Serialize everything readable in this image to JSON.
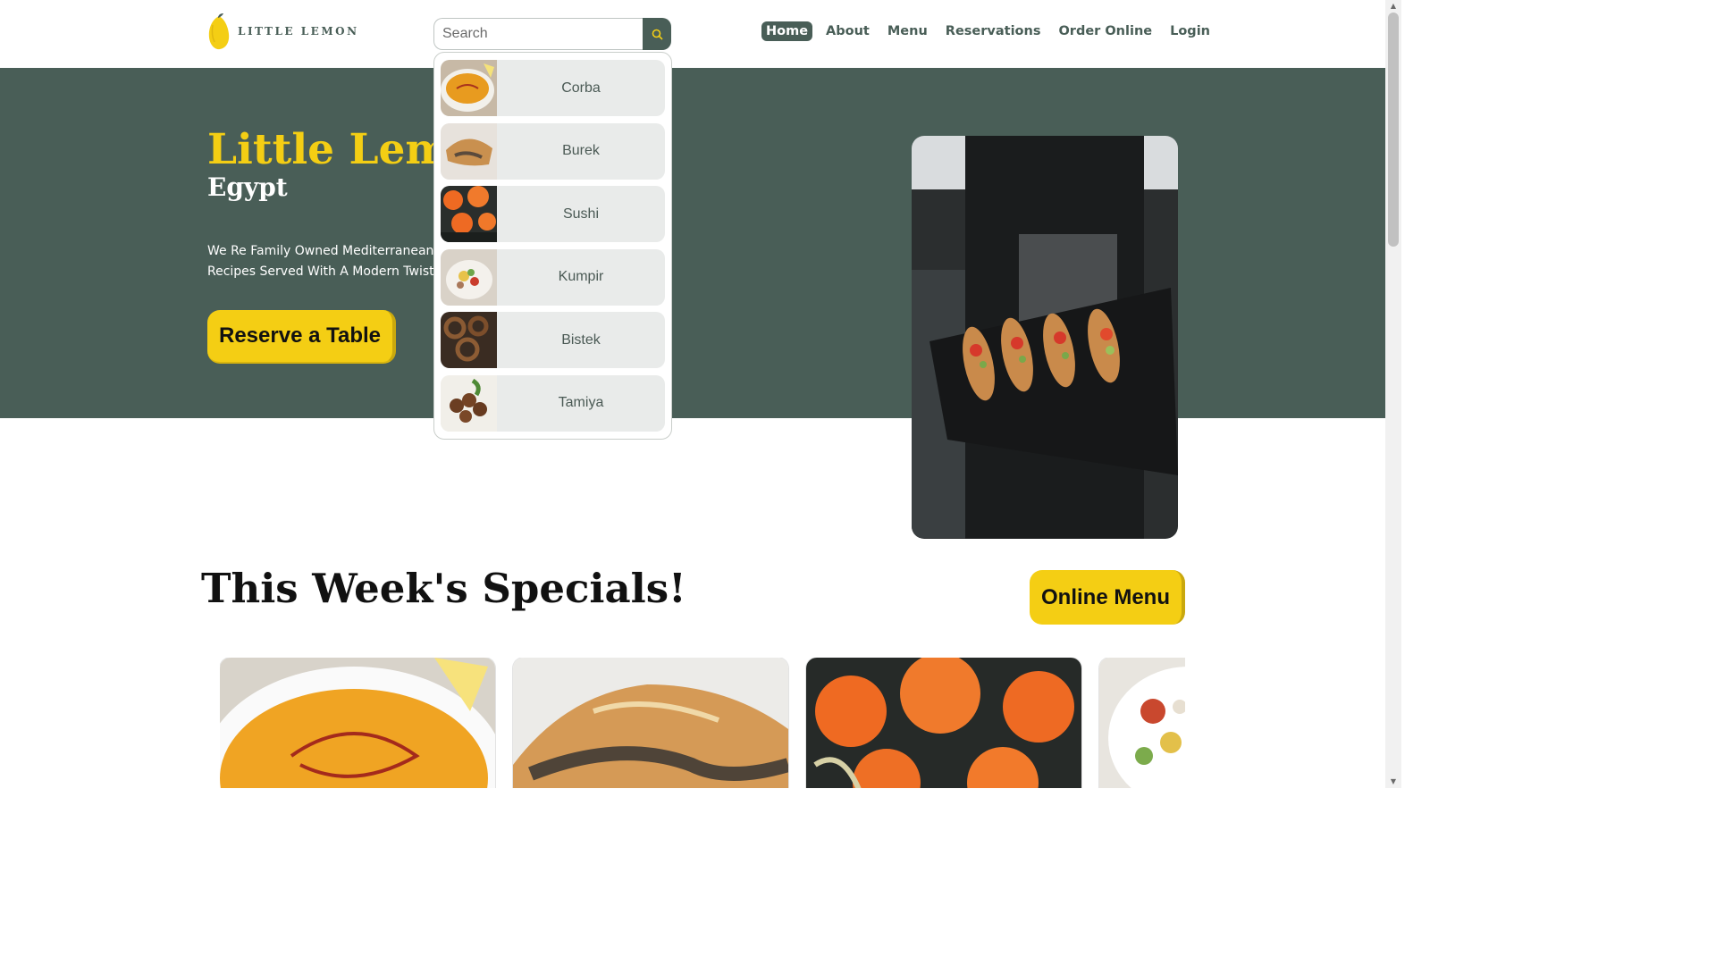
{
  "brand": {
    "name": "LITTLE LEMON"
  },
  "search": {
    "placeholder": "Search",
    "value": ""
  },
  "nav": {
    "items": [
      {
        "label": "Home",
        "active": true
      },
      {
        "label": "About"
      },
      {
        "label": "Menu"
      },
      {
        "label": "Reservations"
      },
      {
        "label": "Order Online"
      },
      {
        "label": "Login"
      }
    ]
  },
  "hero": {
    "title": "Little Lemon",
    "subtitle": "Egypt",
    "description_line1": "We Re Family Owned Mediterranean",
    "description_line2": "Recipes Served With A Modern Twist",
    "cta": "Reserve a Table"
  },
  "dropdown": {
    "items": [
      {
        "label": "Corba",
        "icon": "soup-photo"
      },
      {
        "label": "Burek",
        "icon": "pastry-photo"
      },
      {
        "label": "Sushi",
        "icon": "sushi-photo"
      },
      {
        "label": "Kumpir",
        "icon": "potato-photo"
      },
      {
        "label": "Bistek",
        "icon": "steak-photo"
      },
      {
        "label": "Tamiya",
        "icon": "falafel-photo"
      }
    ]
  },
  "specials": {
    "title": "This Week's Specials!",
    "menu_button": "Online Menu"
  },
  "colors": {
    "primary_green": "#495e57",
    "primary_yellow": "#f4ce14"
  }
}
